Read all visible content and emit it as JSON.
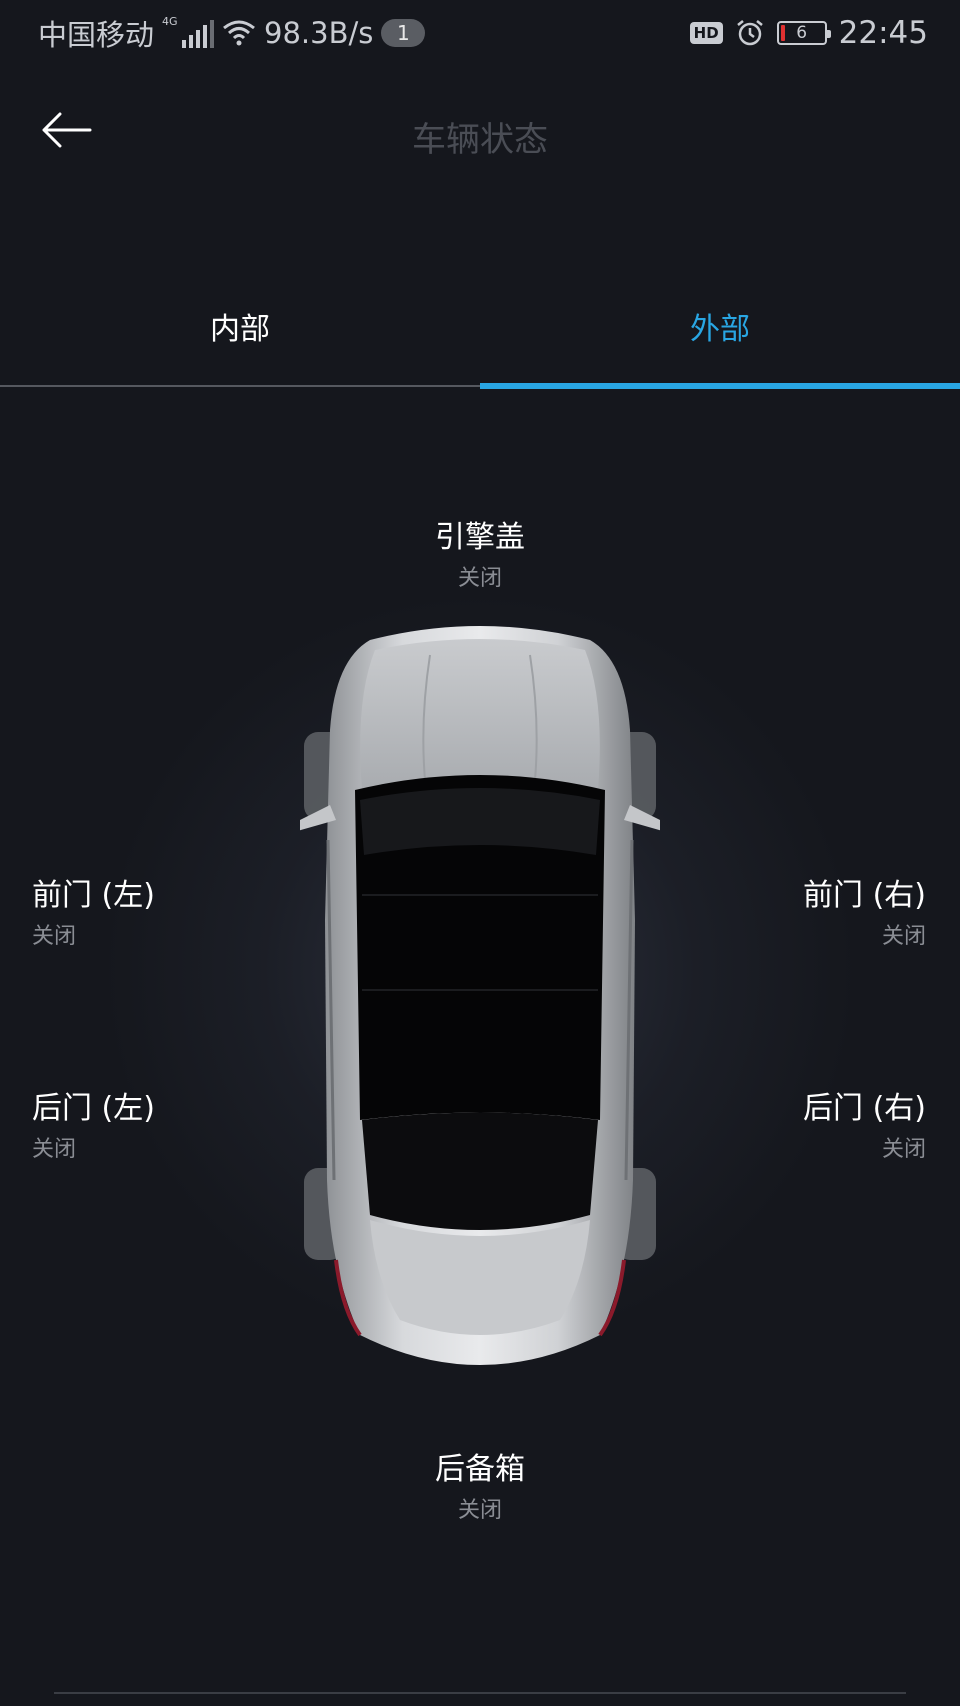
{
  "status_bar": {
    "carrier": "中国移动",
    "network_type": "4G",
    "speed": "98.3B/s",
    "notification_count": "1",
    "hd_label": "HD",
    "battery_level": "6",
    "time": "22:45",
    "icons": [
      "signal-icon",
      "wifi-icon",
      "alarm-icon",
      "battery-icon"
    ]
  },
  "header": {
    "title": "车辆状态",
    "back_icon": "arrow-left-icon"
  },
  "tabs": [
    {
      "label": "内部",
      "active": false
    },
    {
      "label": "外部",
      "active": true
    }
  ],
  "vehicle": {
    "hood": {
      "name": "引擎盖",
      "status": "关闭"
    },
    "front_left": {
      "name": "前门 (左)",
      "status": "关闭"
    },
    "rear_left": {
      "name": "后门 (左)",
      "status": "关闭"
    },
    "front_right": {
      "name": "前门 (右)",
      "status": "关闭"
    },
    "rear_right": {
      "name": "后门 (右)",
      "status": "关闭"
    },
    "trunk": {
      "name": "后备箱",
      "status": "关闭"
    }
  },
  "colors": {
    "background": "#15171d",
    "accent": "#29a6e3",
    "text_primary": "#ffffff",
    "text_secondary": "#8a8d94",
    "title_dim": "#4a4d55"
  }
}
